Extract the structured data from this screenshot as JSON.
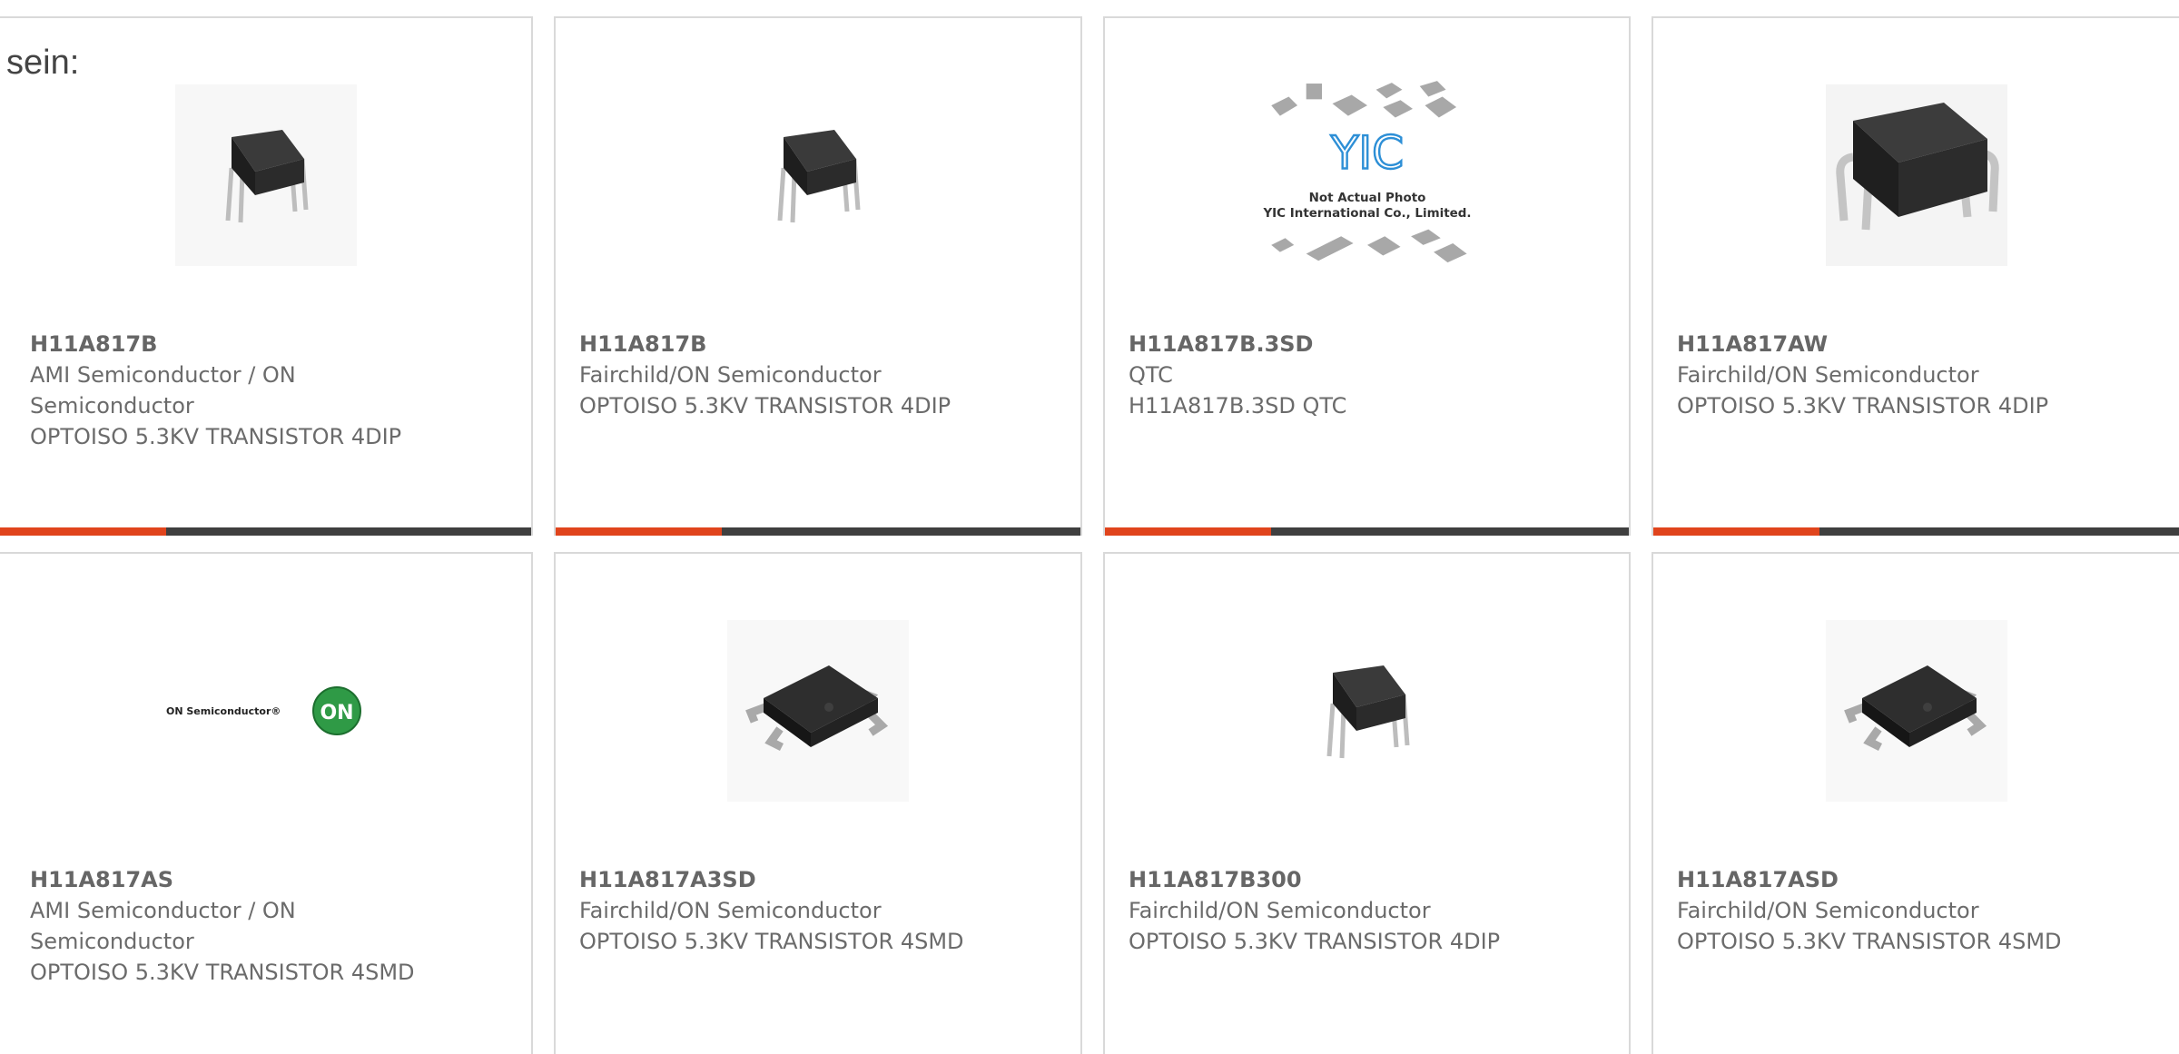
{
  "fragment": "sein:",
  "products": [
    {
      "name": "H11A817B",
      "manufacturer": "AMI Semiconductor / ON Semiconductor",
      "description": "OPTOISO 5.3KV TRANSISTOR 4DIP",
      "image": "dip4-chip-icon"
    },
    {
      "name": "H11A817B",
      "manufacturer": "Fairchild/ON Semiconductor",
      "description": "OPTOISO 5.3KV TRANSISTOR 4DIP",
      "image": "dip4-chip-icon"
    },
    {
      "name": "H11A817B.3SD",
      "manufacturer": "QTC",
      "description": "H11A817B.3SD QTC",
      "image": "yic-placeholder-icon",
      "placeholder_caption_1": "Not Actual Photo",
      "placeholder_caption_2": "YIC International Co., Limited.",
      "placeholder_logo": "YIC"
    },
    {
      "name": "H11A817AW",
      "manufacturer": "Fairchild/ON Semiconductor",
      "description": "OPTOISO 5.3KV TRANSISTOR 4DIP",
      "image": "dip4-wide-chip-icon"
    },
    {
      "name": "H11A817AS",
      "manufacturer": "AMI Semiconductor / ON Semiconductor",
      "description": "OPTOISO 5.3KV TRANSISTOR 4SMD",
      "image": "on-semiconductor-logo",
      "logo_text": "ON Semiconductor®",
      "logo_badge": "ON"
    },
    {
      "name": "H11A817A3SD",
      "manufacturer": "Fairchild/ON Semiconductor",
      "description": "OPTOISO 5.3KV TRANSISTOR 4SMD",
      "image": "smd4-chip-icon"
    },
    {
      "name": "H11A817B300",
      "manufacturer": "Fairchild/ON Semiconductor",
      "description": "OPTOISO 5.3KV TRANSISTOR 4DIP",
      "image": "dip4-chip-icon"
    },
    {
      "name": "H11A817ASD",
      "manufacturer": "Fairchild/ON Semiconductor",
      "description": "OPTOISO 5.3KV TRANSISTOR 4SMD",
      "image": "smd4-chip-icon"
    }
  ],
  "colors": {
    "accent": "#e0441c",
    "bar": "#3f3f3f",
    "border": "#d9d9d9",
    "text": "#6b6b6b"
  }
}
